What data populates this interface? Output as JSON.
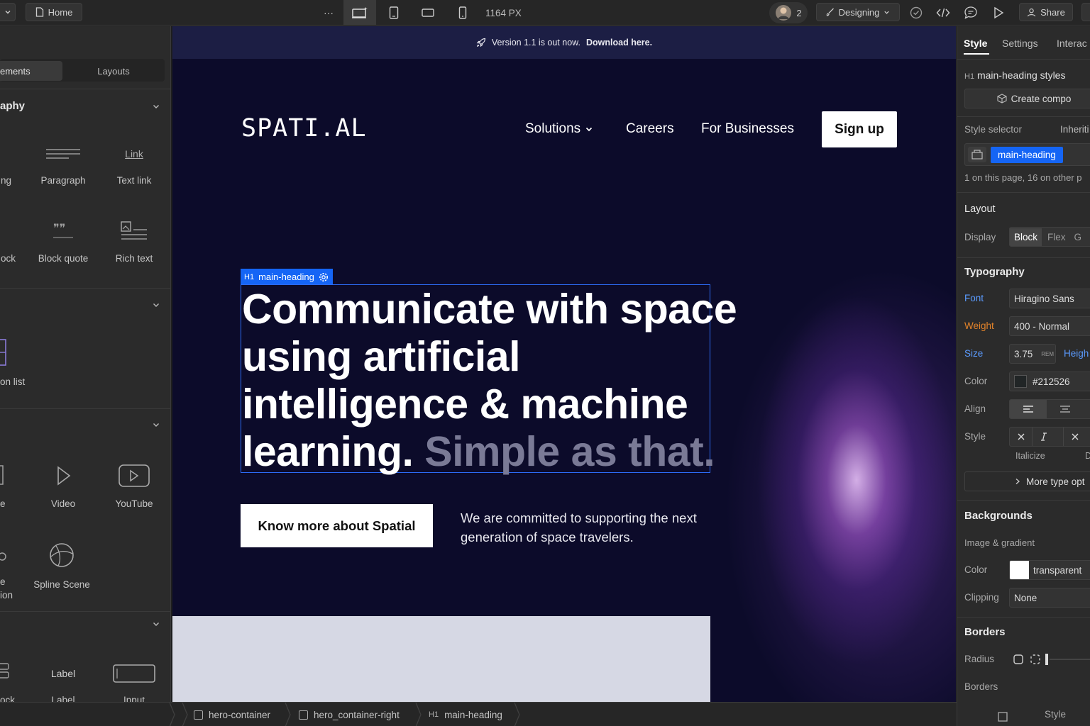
{
  "topbar": {
    "home_label": "Home",
    "more_label": "···",
    "width_readout": "1164 PX",
    "collaborators_count": "2",
    "mode_label": "Designing",
    "share_label": "Share"
  },
  "left_panel": {
    "tabs": [
      {
        "label": "Elements",
        "visible": "ements"
      },
      {
        "label": "Layouts",
        "visible": "Layouts"
      }
    ],
    "typography_section": "aphy",
    "items": {
      "heading_partial": "ng",
      "paragraph": "Paragraph",
      "text_link": "Text link",
      "link_icon_text": "Link",
      "block_partial": "ock",
      "block_quote": "Block quote",
      "rich_text": "Rich text",
      "list_partial": "on list",
      "image_partial": "e",
      "video": "Video",
      "youtube": "YouTube",
      "lottie_partial_1": "e",
      "lottie_partial_2": "ion",
      "spline": "Spline Scene",
      "form_block_partial": "ock",
      "label": "Label",
      "label_icon_text": "Label",
      "input": "Input"
    }
  },
  "canvas": {
    "banner_text": "Version 1.1 is out now.",
    "banner_link": "Download here.",
    "logo": "SPATI.AL",
    "nav": {
      "solutions": "Solutions",
      "careers": "Careers",
      "businesses": "For Businesses",
      "signup": "Sign up"
    },
    "selection_tag": "main-heading",
    "selection_tag_prefix": "H1",
    "heading_main": "Communicate with space using artificial intelligence & machine learning.",
    "heading_dim": "Simple as that.",
    "cta": "Know more about Spatial",
    "subtext": "We are committed to supporting the next generation of space travelers."
  },
  "right_panel": {
    "tabs": {
      "style": "Style",
      "settings": "Settings",
      "interactions": "Interac"
    },
    "selected_prefix": "H1",
    "selected_name": "main-heading styles",
    "create_component": "Create compo",
    "style_selector_label": "Style selector",
    "inherit_label": "Inheriti",
    "selector_class": "main-heading",
    "usage_note": "1 on this page, 16 on other p",
    "layout_heading": "Layout",
    "display_label": "Display",
    "display_options": [
      "Block",
      "Flex",
      "G"
    ],
    "typography_heading": "Typography",
    "font_label": "Font",
    "font_value": "Hiragino Sans",
    "weight_label": "Weight",
    "weight_value": "400 - Normal",
    "size_label": "Size",
    "size_value": "3.75",
    "size_unit": "REM",
    "height_label": "Heigh",
    "color_label": "Color",
    "color_value": "#212526",
    "align_label": "Align",
    "style_label": "Style",
    "italicize_label": "Italicize",
    "decoration_partial": "D",
    "more_type": "More type opt",
    "backgrounds_heading": "Backgrounds",
    "image_gradient_label": "Image & gradient",
    "bg_color_label": "Color",
    "bg_color_value": "transparent",
    "clipping_label": "Clipping",
    "clipping_value": "None",
    "borders_heading": "Borders",
    "radius_label": "Radius",
    "borders_label": "Borders",
    "bottom_style_label": "Style"
  },
  "breadcrumb": {
    "items": [
      {
        "label": "hero-container"
      },
      {
        "label": "hero_container-right"
      },
      {
        "prefix": "H1",
        "label": "main-heading"
      }
    ]
  },
  "colors": {
    "accent": "#1565f5",
    "canvas_bg": "#0c0b2a",
    "panel_bg": "#2b2b2b",
    "topbar_bg": "#262626"
  }
}
